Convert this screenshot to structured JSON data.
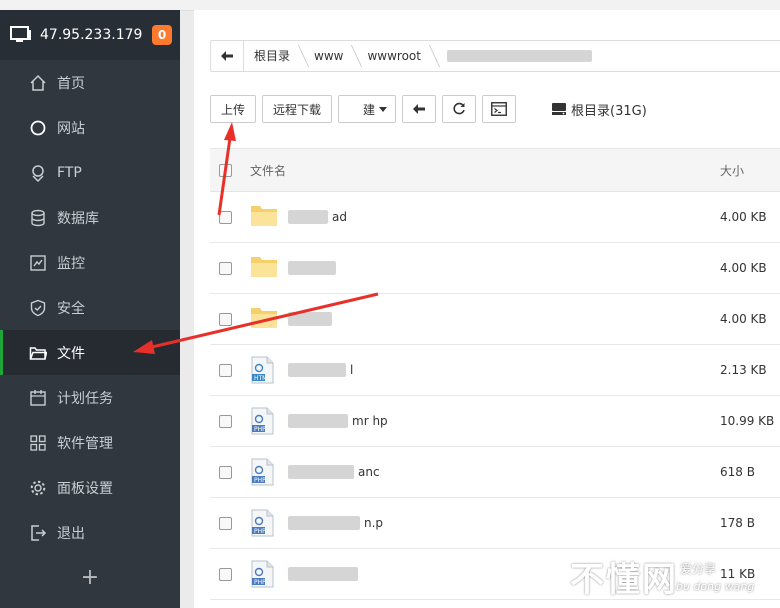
{
  "sidebar": {
    "server_ip": "47.95.233.179",
    "badge": "0",
    "items": [
      {
        "label": "首页",
        "icon": "home-icon"
      },
      {
        "label": "网站",
        "icon": "globe-icon"
      },
      {
        "label": "FTP",
        "icon": "ftp-icon"
      },
      {
        "label": "数据库",
        "icon": "database-icon"
      },
      {
        "label": "监控",
        "icon": "monitor-icon"
      },
      {
        "label": "安全",
        "icon": "shield-icon"
      },
      {
        "label": "文件",
        "icon": "folder-icon"
      },
      {
        "label": "计划任务",
        "icon": "calendar-icon"
      },
      {
        "label": "软件管理",
        "icon": "grid-icon"
      },
      {
        "label": "面板设置",
        "icon": "gear-icon"
      },
      {
        "label": "退出",
        "icon": "logout-icon"
      }
    ],
    "active_item": "文件",
    "add_label": "+"
  },
  "path": {
    "crumbs": [
      "根目录",
      "www",
      "wwwroot"
    ]
  },
  "toolbar": {
    "upload": "上传",
    "remote_download": "远程下载",
    "new_partial": "建",
    "disk_label": "根目录(31G)"
  },
  "table": {
    "col_name": "文件名",
    "col_size": "大小",
    "rows": [
      {
        "type": "folder",
        "name": "ad",
        "size": "4.00 KB"
      },
      {
        "type": "folder",
        "name": "",
        "size": "4.00 KB"
      },
      {
        "type": "folder",
        "name": "",
        "size": "4.00 KB"
      },
      {
        "type": "html",
        "name": "l",
        "size": "2.13 KB"
      },
      {
        "type": "php",
        "name": "mr hp",
        "size": "10.99 KB"
      },
      {
        "type": "php",
        "name": "anc",
        "size": "618 B"
      },
      {
        "type": "php",
        "name": "n.p",
        "size": "178 B"
      },
      {
        "type": "php",
        "name": "",
        "size": "11 KB"
      }
    ]
  },
  "watermark": {
    "main": "不懂网",
    "sub1": "爱分享",
    "sub2": "bu dong wang"
  },
  "colors": {
    "sidebar_bg": "#30373f",
    "active_accent": "#20a53a",
    "badge": "#ff7a2e",
    "arrow": "#e8302a"
  }
}
